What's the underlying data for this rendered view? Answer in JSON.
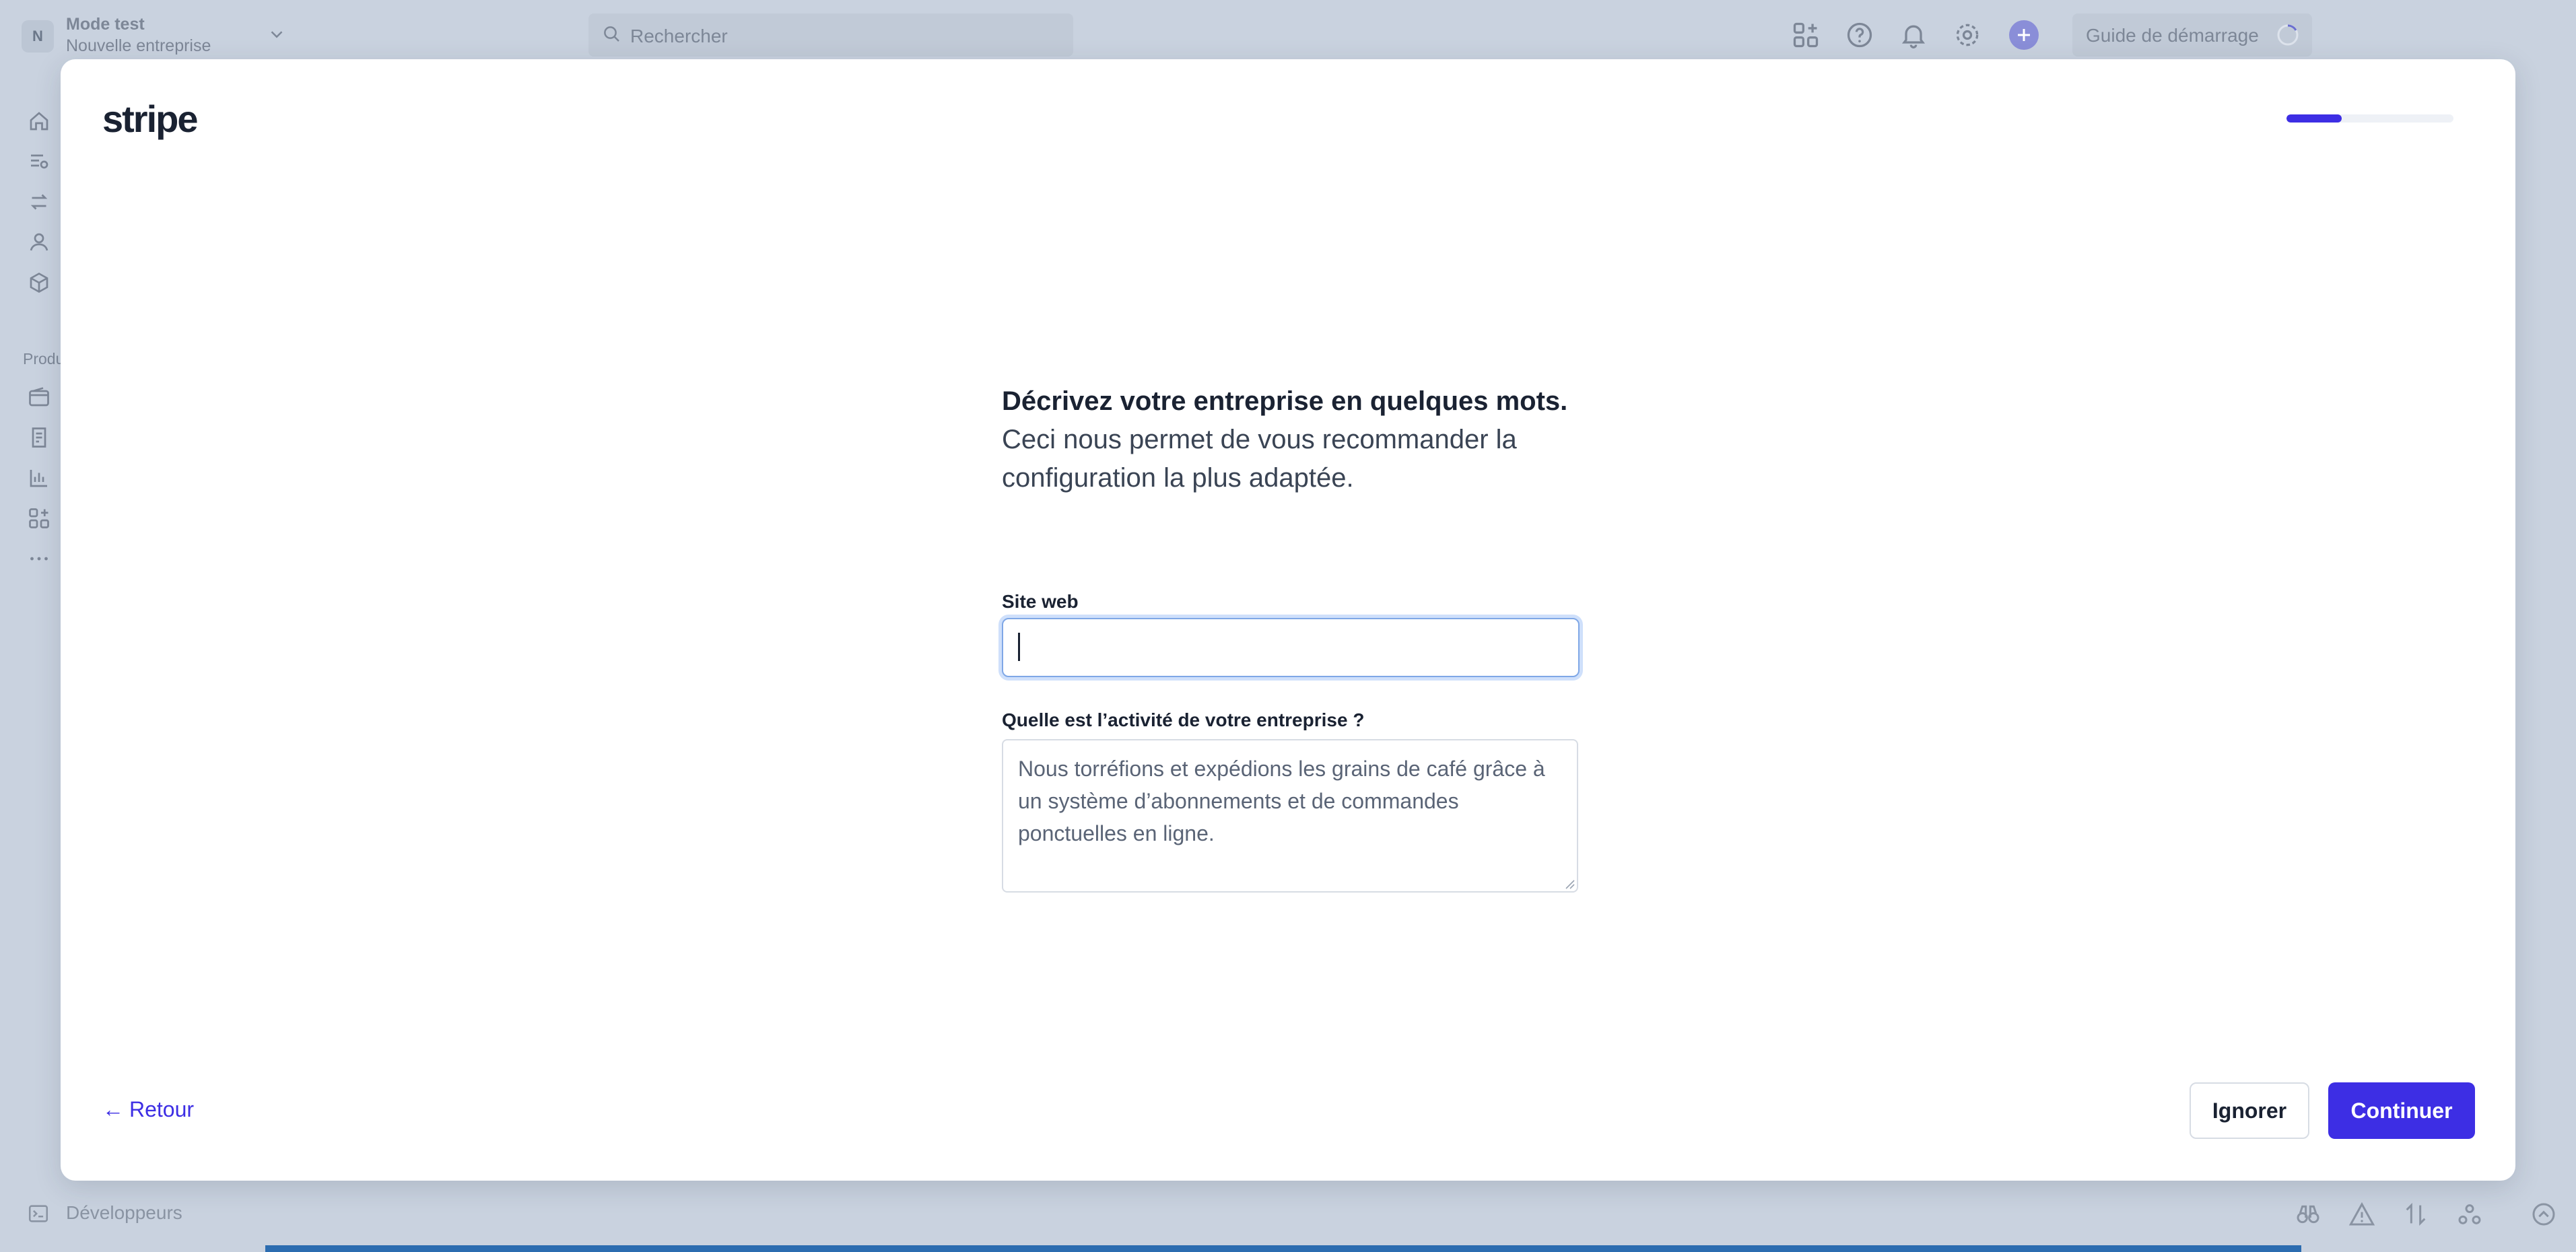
{
  "background": {
    "account": {
      "avatar_letter": "N",
      "mode": "Mode test",
      "name": "Nouvelle entreprise"
    },
    "search": {
      "placeholder": "Rechercher"
    },
    "topbar_icons": [
      "apps-icon",
      "help-icon",
      "bell-icon",
      "gear-icon",
      "plus-icon"
    ],
    "guide": {
      "label": "Guide de démarrage"
    },
    "sidebar": {
      "icons": [
        "home-icon",
        "list-icon",
        "transfer-icon",
        "customer-icon",
        "product-icon",
        "wallet-icon",
        "invoice-icon",
        "chart-icon",
        "apps-icon",
        "more-icon"
      ],
      "section_heading": "Produ"
    },
    "bottombar": {
      "label": "Développeurs",
      "icons": [
        "binoculars-icon",
        "warning-icon",
        "arrows-icon",
        "webhook-icon",
        "chevron-up-icon"
      ]
    }
  },
  "modal": {
    "logo": "stripe",
    "progress": 0.33,
    "headline_strong": "Décrivez votre entreprise en quelques mots.",
    "headline_sub": "Ceci nous permet de vous recommander la configuration la plus adaptée.",
    "website": {
      "label": "Site web",
      "value": ""
    },
    "activity": {
      "label": "Quelle est l’activité de votre entreprise ?",
      "placeholder": "Nous torréfions et expédions les grains de café grâce à un système d’abonnements et de commandes ponctuelles en ligne."
    },
    "back_label": "Retour",
    "skip_label": "Ignorer",
    "continue_label": "Continuer"
  },
  "colors": {
    "accent": "#3d2ee4",
    "focus_ring": "#cfe0fb",
    "backdrop": "#c9d2df"
  }
}
